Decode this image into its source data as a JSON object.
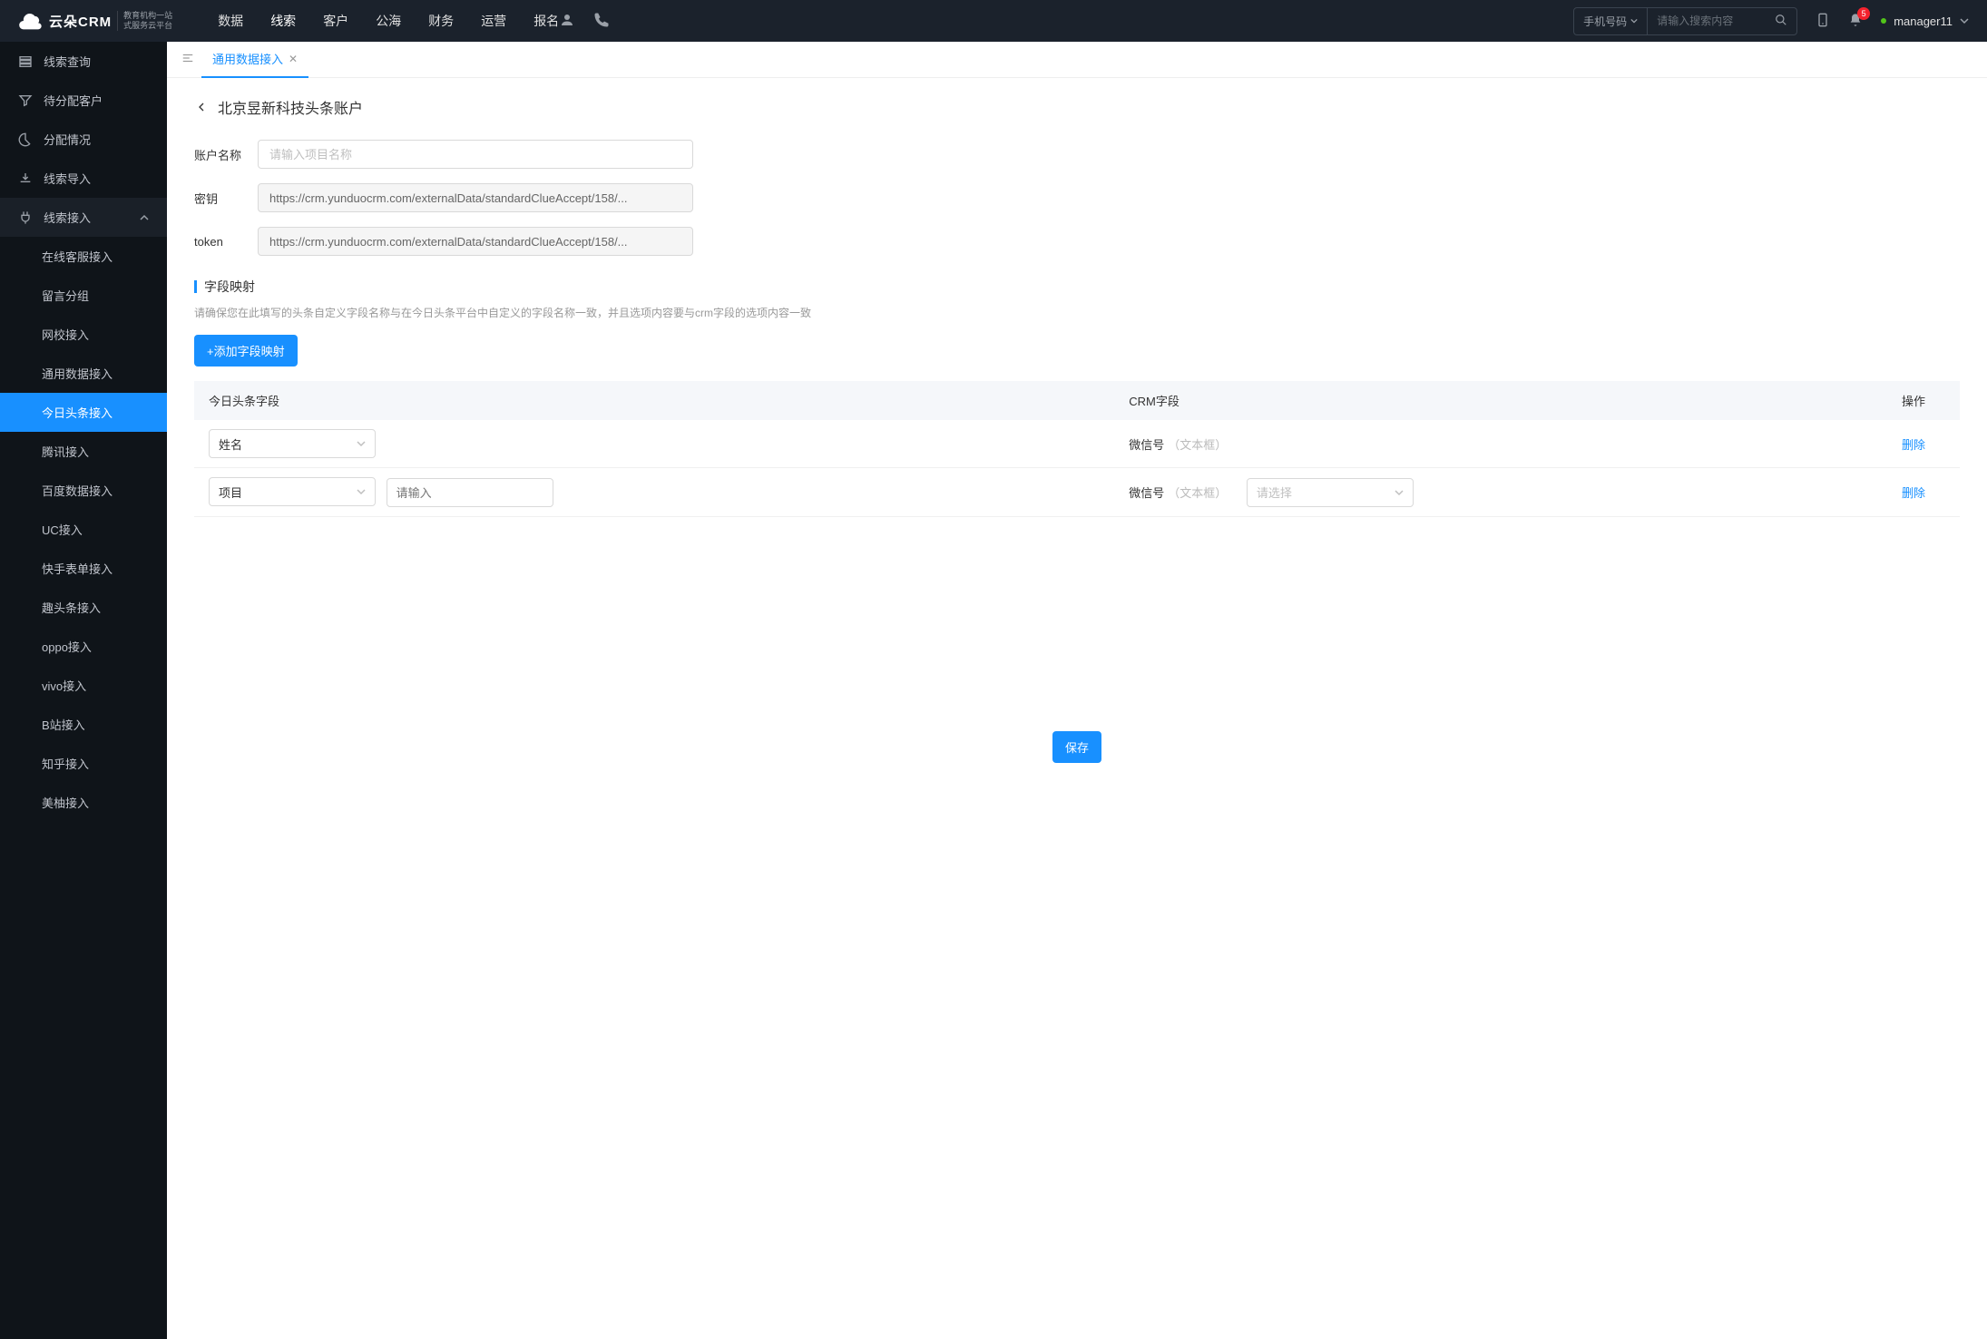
{
  "header": {
    "logo_text": "云朵CRM",
    "logo_sub1": "教育机构一站",
    "logo_sub2": "式服务云平台",
    "nav": [
      "数据",
      "线索",
      "客户",
      "公海",
      "财务",
      "运营",
      "报名"
    ],
    "nav_active": 1,
    "search_type": "手机号码",
    "search_placeholder": "请输入搜索内容",
    "notif_count": "5",
    "user": "manager11"
  },
  "sidebar": {
    "items": [
      {
        "label": "线索查询",
        "icon": "list"
      },
      {
        "label": "待分配客户",
        "icon": "filter"
      },
      {
        "label": "分配情况",
        "icon": "pie"
      },
      {
        "label": "线索导入",
        "icon": "export"
      },
      {
        "label": "线索接入",
        "icon": "plug",
        "expanded": true,
        "children": [
          "在线客服接入",
          "留言分组",
          "网校接入",
          "通用数据接入",
          "今日头条接入",
          "腾讯接入",
          "百度数据接入",
          "UC接入",
          "快手表单接入",
          "趣头条接入",
          "oppo接入",
          "vivo接入",
          "B站接入",
          "知乎接入",
          "美柚接入"
        ],
        "active_child": 4
      }
    ]
  },
  "tabs": {
    "active": "通用数据接入"
  },
  "page": {
    "title": "北京昱新科技头条账户",
    "form": {
      "name_label": "账户名称",
      "name_placeholder": "请输入项目名称",
      "secret_label": "密钥",
      "secret_value": "https://crm.yunduocrm.com/externalData/standardClueAccept/158/...",
      "token_label": "token",
      "token_value": "https://crm.yunduocrm.com/externalData/standardClueAccept/158/..."
    },
    "mapping": {
      "title": "字段映射",
      "desc": "请确保您在此填写的头条自定义字段名称与在今日头条平台中自定义的字段名称一致，并且选项内容要与crm字段的选项内容一致",
      "add_btn": "+添加字段映射",
      "cols": {
        "c1": "今日头条字段",
        "c2": "CRM字段",
        "c3": "操作"
      },
      "rows": [
        {
          "tt_field": "姓名",
          "crm_name": "微信号",
          "crm_type": "（文本框）",
          "del": "删除"
        },
        {
          "tt_field": "项目",
          "tt_input_ph": "请输入",
          "crm_name": "微信号",
          "crm_type": "（文本框）",
          "crm_select_ph": "请选择",
          "del": "删除"
        }
      ]
    },
    "save_btn": "保存"
  }
}
